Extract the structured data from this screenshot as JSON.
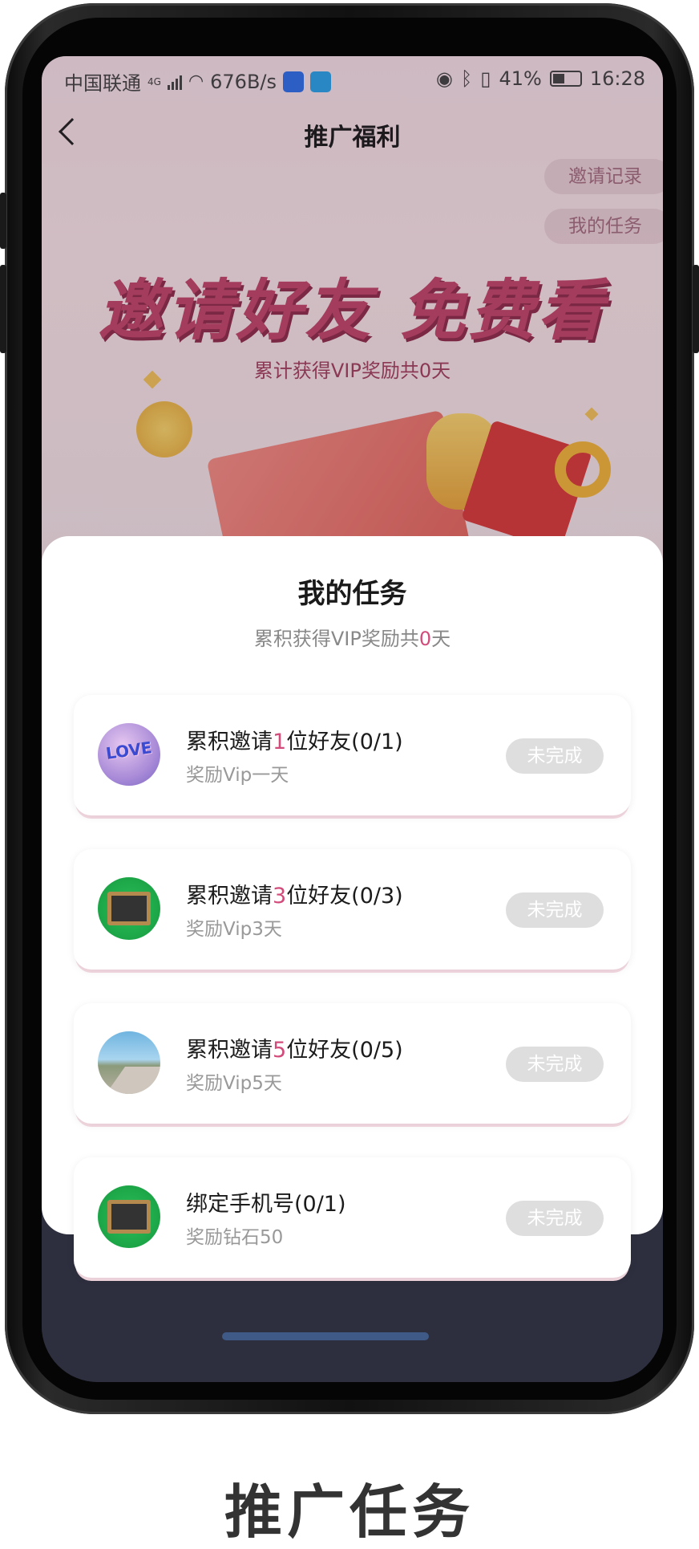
{
  "status_bar": {
    "carrier": "中国联通",
    "network_tag": "4G",
    "speed": "676B/s",
    "battery": "41%",
    "time": "16:28"
  },
  "nav": {
    "title": "推广福利",
    "invite_record": "邀请记录",
    "my_tasks": "我的任务"
  },
  "hero": {
    "headline": "邀请好友 免费看",
    "summary": "累计获得VIP奖励共0天"
  },
  "sheet": {
    "title": "我的任务",
    "summary_prefix": "累积获得VIP奖励共",
    "summary_value": "0",
    "summary_suffix": "天",
    "tasks": [
      {
        "title_prefix": "累积邀请",
        "title_num": "1",
        "title_suffix": "位好友(0/1)",
        "reward": "奖励Vip一天",
        "status": "未完成",
        "thumb": "love-thumbnail"
      },
      {
        "title_prefix": "累积邀请",
        "title_num": "3",
        "title_suffix": "位好友(0/3)",
        "reward": "奖励Vip3天",
        "status": "未完成",
        "thumb": "chalkboard-thumbnail"
      },
      {
        "title_prefix": "累积邀请",
        "title_num": "5",
        "title_suffix": "位好友(0/5)",
        "reward": "奖励Vip5天",
        "status": "未完成",
        "thumb": "road-thumbnail"
      },
      {
        "title_prefix": "绑定手机号(0/1)",
        "title_num": "",
        "title_suffix": "",
        "reward": "奖励钻石50",
        "status": "未完成",
        "thumb": "chalkboard-thumbnail"
      }
    ]
  },
  "caption": "推广任务",
  "colors": {
    "accent": "#d24c7b",
    "headline": "#c0466a",
    "button_disabled": "#dedede"
  }
}
